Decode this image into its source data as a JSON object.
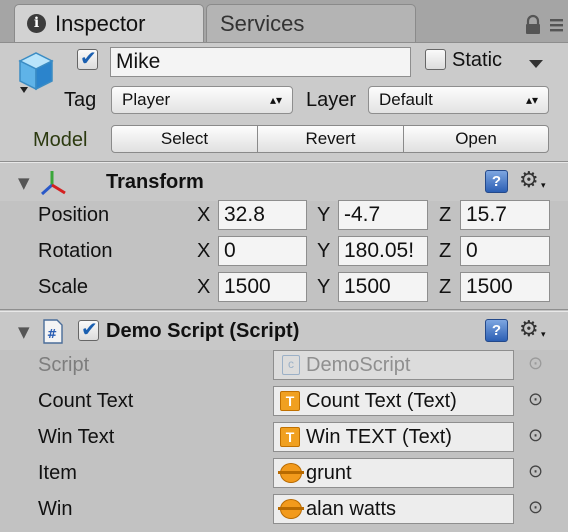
{
  "tabs": {
    "inspector": "Inspector",
    "services": "Services"
  },
  "object": {
    "active": true,
    "name": "Mike",
    "static_label": "Static",
    "static": false,
    "tag_label": "Tag",
    "tag_value": "Player",
    "layer_label": "Layer",
    "layer_value": "Default"
  },
  "model": {
    "label": "Model",
    "buttons": {
      "select": "Select",
      "revert": "Revert",
      "open": "Open"
    }
  },
  "transform": {
    "title": "Transform",
    "axes": {
      "x": "X",
      "y": "Y",
      "z": "Z"
    },
    "position": {
      "label": "Position",
      "x": "32.8",
      "y": "-4.7",
      "z": "15.7"
    },
    "rotation": {
      "label": "Rotation",
      "x": "0",
      "y": "180.05!",
      "z": "0"
    },
    "scale": {
      "label": "Scale",
      "x": "1500",
      "y": "1500",
      "z": "1500"
    }
  },
  "script_component": {
    "title": "Demo Script (Script)",
    "enabled": true,
    "fields": {
      "script": {
        "label": "Script",
        "value": "DemoScript"
      },
      "count_text": {
        "label": "Count Text",
        "value": "Count Text (Text)"
      },
      "win_text": {
        "label": "Win Text",
        "value": "Win TEXT (Text)"
      },
      "item": {
        "label": "Item",
        "value": "grunt"
      },
      "win": {
        "label": "Win",
        "value": "alan watts"
      }
    }
  },
  "colors": {
    "panel": "#c2c2c2",
    "help_icon": "#2c5fb4",
    "object_icon": "#f29a1c",
    "text_icon": "#f0a020"
  }
}
